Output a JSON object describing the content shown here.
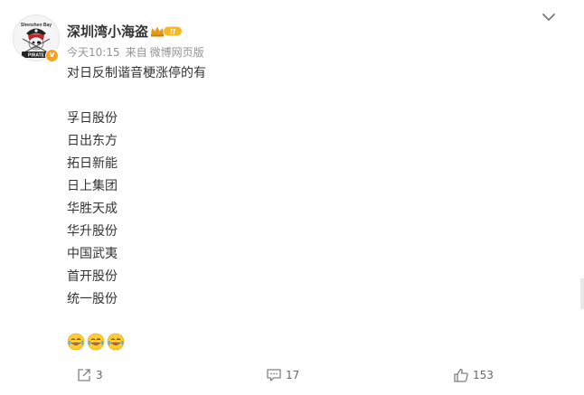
{
  "post": {
    "author": {
      "name": "深圳湾小海盗",
      "avatar_label": "PIRATE",
      "avatar_small_text": "Shenzhen Bay",
      "member_level": "II",
      "verify_badge": "v"
    },
    "meta": {
      "time": "今天10:15",
      "source_prefix": "来自",
      "source": "微博网页版"
    },
    "text": "对日反制谐音梗涨停的有",
    "items": [
      "孚日股份",
      "日出东方",
      "拓日新能",
      "日上集团",
      "华胜天成",
      "华升股份",
      "中国武夷",
      "首开股份",
      "统一股份"
    ],
    "emojis": [
      "laugh-cry-emoji",
      "laugh-cry-emoji",
      "laugh-cry-emoji"
    ],
    "actions": {
      "repost_count": "3",
      "comment_count": "17",
      "like_count": "153"
    }
  },
  "colors": {
    "text": "#333333",
    "meta": "#939393",
    "badge": "#f7a21b",
    "avatar_red": "#c8242b"
  }
}
